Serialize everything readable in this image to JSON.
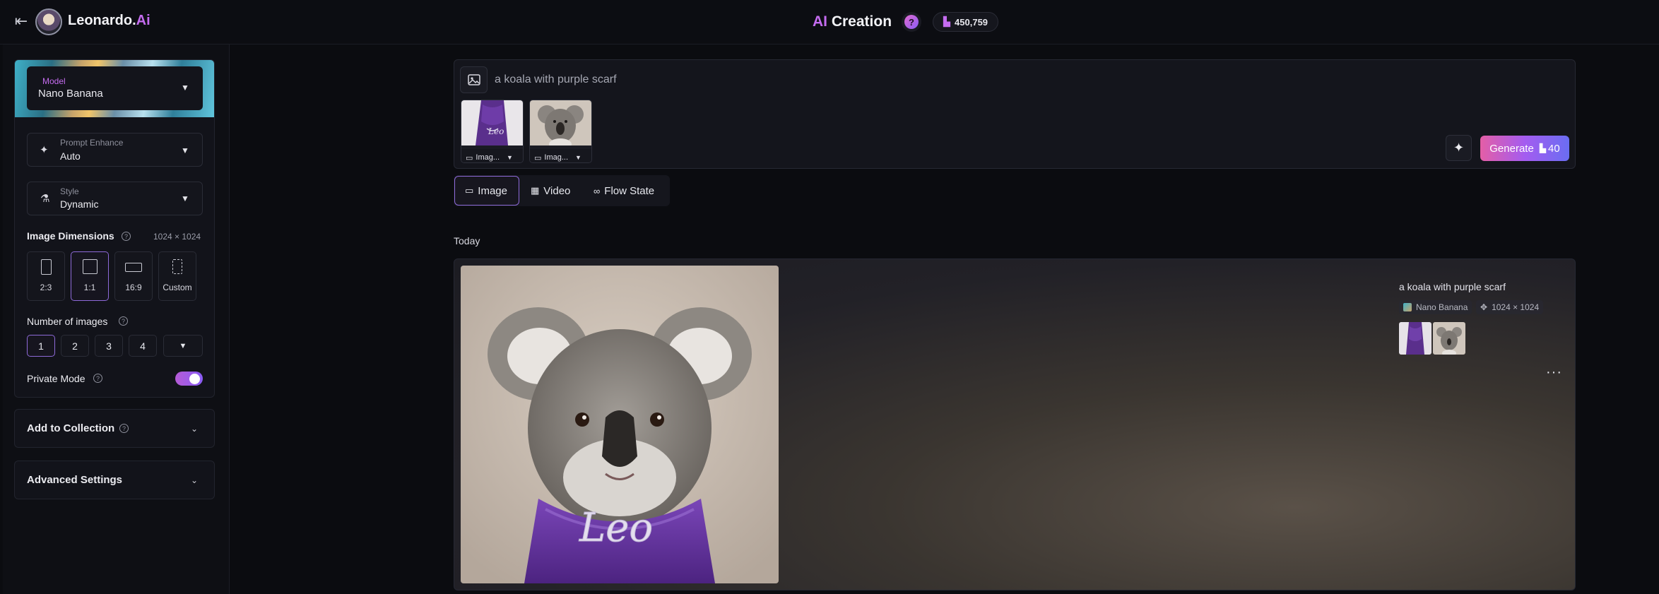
{
  "header": {
    "brand": "Leonardo.",
    "brand_accent": "Ai",
    "title_accent": "AI",
    "title": "Creation",
    "help": "?",
    "tokens": "450,759"
  },
  "sidebar": {
    "model": {
      "label": "Model",
      "value": "Nano Banana"
    },
    "prompt_enhance": {
      "label": "Prompt Enhance",
      "value": "Auto"
    },
    "style": {
      "label": "Style",
      "value": "Dynamic"
    },
    "dimensions": {
      "title": "Image Dimensions",
      "value": "1024 × 1024",
      "options": [
        {
          "label": "2:3"
        },
        {
          "label": "1:1",
          "active": true
        },
        {
          "label": "16:9"
        },
        {
          "label": "Custom"
        }
      ]
    },
    "number_of_images": {
      "title": "Number of images",
      "options": [
        "1",
        "2",
        "3",
        "4"
      ],
      "selected": "1"
    },
    "private_mode": {
      "label": "Private Mode",
      "enabled": true
    },
    "add_to_collection": "Add to Collection",
    "advanced_settings": "Advanced Settings"
  },
  "prompt": {
    "value": "a koala with purple scarf",
    "references": [
      {
        "label": "Imag..."
      },
      {
        "label": "Imag..."
      }
    ],
    "generate_label": "Generate",
    "generate_cost": "40"
  },
  "mode_tabs": [
    {
      "label": "Image",
      "active": true
    },
    {
      "label": "Video"
    },
    {
      "label": "Flow State"
    }
  ],
  "feed": {
    "section": "Today",
    "result": {
      "prompt": "a koala with purple scarf",
      "model": "Nano Banana",
      "size": "1024 × 1024",
      "scarf_text": "Leo",
      "more": "···"
    }
  },
  "colors": {
    "accent": "#c56cf0",
    "active_border": "#8e6ad9",
    "background": "#0b0c10"
  }
}
